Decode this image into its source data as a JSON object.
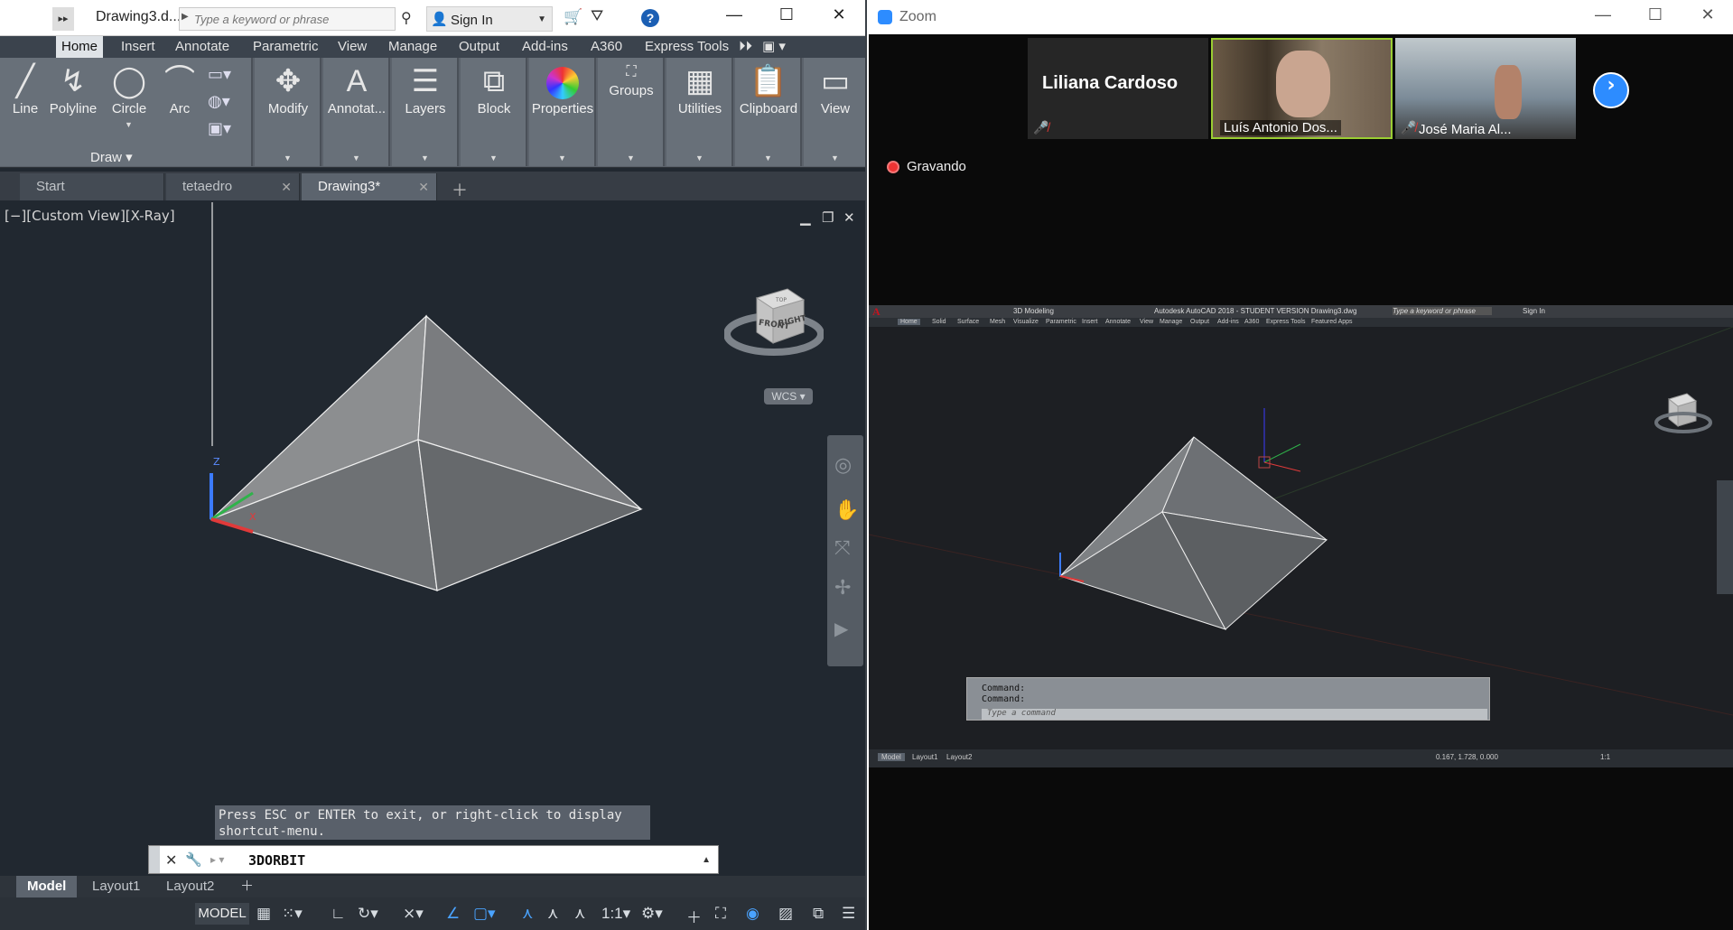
{
  "acad": {
    "doc_title": "Drawing3.d...",
    "search_placeholder": "Type a keyword or phrase",
    "sign_in": "Sign In",
    "ribbon_tabs": [
      "Home",
      "Insert",
      "Annotate",
      "Parametric",
      "View",
      "Manage",
      "Output",
      "Add-ins",
      "A360",
      "Express Tools"
    ],
    "draw_tools": [
      "Line",
      "Polyline",
      "Circle",
      "Arc"
    ],
    "draw_panel_label": "Draw",
    "panels": [
      "Modify",
      "Annotat...",
      "Layers",
      "Block",
      "Properties",
      "Groups",
      "Utilities",
      "Clipboard",
      "View"
    ],
    "file_tabs": [
      "Start",
      "tetaedro",
      "Drawing3*"
    ],
    "view_label": "[−][Custom View][X-Ray]",
    "viewcube": {
      "front": "FRONT",
      "right": "RIGHT",
      "top": "TOP",
      "wcs": "WCS"
    },
    "cmd_history": "Press ESC or ENTER to exit, or right-click to display shortcut-menu.",
    "cmd_value": "3DORBIT",
    "layout_tabs": [
      "Model",
      "Layout1",
      "Layout2"
    ],
    "status": {
      "model": "MODEL",
      "scale": "1:1"
    }
  },
  "zoom": {
    "title": "Zoom",
    "participants": [
      {
        "name": "Liliana Cardoso"
      },
      {
        "name": "Luís Antonio Dos..."
      },
      {
        "name": "José Maria Al..."
      }
    ],
    "recording": "Gravando",
    "share": {
      "workspace": "3D Modeling",
      "title": "Autodesk AutoCAD 2018 - STUDENT VERSION     Drawing3.dwg",
      "search": "Type a keyword or phrase",
      "signin": "Sign In",
      "tabs": [
        "Home",
        "Solid",
        "Surface",
        "Mesh",
        "Visualize",
        "Parametric",
        "Insert",
        "Annotate",
        "View",
        "Manage",
        "Output",
        "Add-ins",
        "A360",
        "Express Tools",
        "Featured Apps"
      ],
      "cmd1": "Command:",
      "cmd2": "Command:",
      "cmd_placeholder": "Type a command",
      "layout_tabs": [
        "Model",
        "Layout1",
        "Layout2"
      ],
      "coords": "0.167, 1.728, 0.000",
      "scale": "1:1"
    }
  },
  "colors": {
    "acad_bg": "#212830",
    "ribbon": "#5b626b",
    "zoom_blue": "#2d8cff",
    "rec_red": "#e33333"
  }
}
